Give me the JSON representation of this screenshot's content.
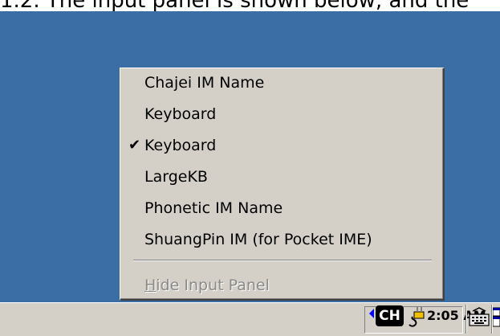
{
  "caption": {
    "text": "1.2. The input panel is shown below, and the"
  },
  "menu": {
    "items": [
      {
        "label": "Chajei IM Name",
        "checked": false
      },
      {
        "label": "Keyboard",
        "checked": false
      },
      {
        "label": "Keyboard",
        "checked": true
      },
      {
        "label": "LargeKB",
        "checked": false
      },
      {
        "label": "Phonetic IM Name",
        "checked": false
      },
      {
        "label": "ShuangPin IM (for Pocket IME)",
        "checked": false
      }
    ],
    "check_mark": "✔",
    "hide_panel": {
      "label_hotkey": "H",
      "label_rest": "ide Input Panel",
      "enabled": false
    }
  },
  "taskbar": {
    "input_language": "CH",
    "clock": "2:05 AM",
    "icons": [
      "arrow-left-icon",
      "power-plug-icon",
      "keyboard-icon",
      "switch-windows-icon"
    ]
  },
  "colors": {
    "desktop": "#3a6ea5",
    "menu_face": "#d4d0c8",
    "disabled_text": "#8a8a8a",
    "tray_arrow": "#0000ff"
  }
}
